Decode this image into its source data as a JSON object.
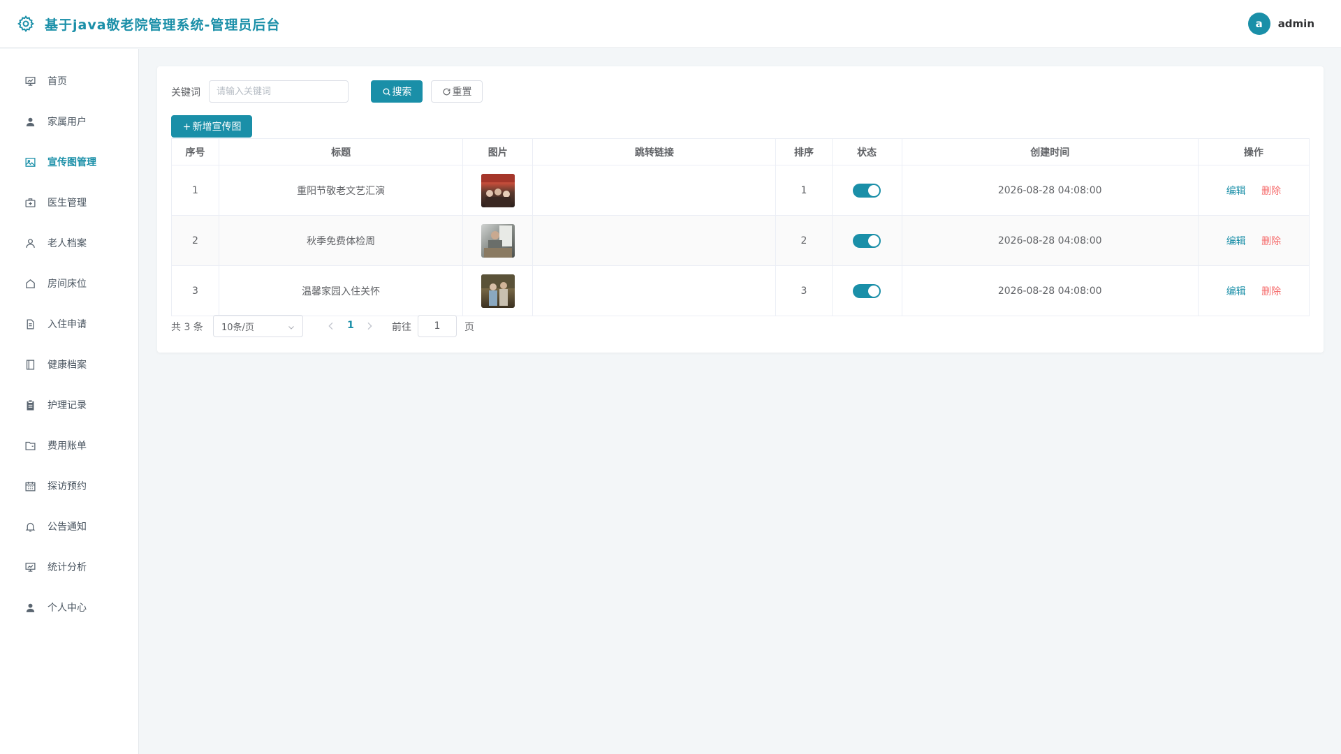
{
  "header": {
    "title": "基于java敬老院管理系统-管理员后台",
    "user": {
      "avatar_letter": "a",
      "name": "admin"
    }
  },
  "sidebar": {
    "items": [
      {
        "label": "首页",
        "icon": "chart-board-icon",
        "active": false
      },
      {
        "label": "家属用户",
        "icon": "user-icon",
        "active": false
      },
      {
        "label": "宣传图管理",
        "icon": "picture-icon",
        "active": true
      },
      {
        "label": "医生管理",
        "icon": "first-aid-icon",
        "active": false
      },
      {
        "label": "老人档案",
        "icon": "user-outline-icon",
        "active": false
      },
      {
        "label": "房间床位",
        "icon": "house-icon",
        "active": false
      },
      {
        "label": "入住申请",
        "icon": "document-icon",
        "active": false
      },
      {
        "label": "健康档案",
        "icon": "notebook-icon",
        "active": false
      },
      {
        "label": "护理记录",
        "icon": "clipboard-icon",
        "active": false
      },
      {
        "label": "费用账单",
        "icon": "wallet-icon",
        "active": false
      },
      {
        "label": "探访预约",
        "icon": "calendar-icon",
        "active": false
      },
      {
        "label": "公告通知",
        "icon": "bell-icon",
        "active": false
      },
      {
        "label": "统计分析",
        "icon": "chart-board-icon",
        "active": false
      },
      {
        "label": "个人中心",
        "icon": "user-icon",
        "active": false
      }
    ]
  },
  "search": {
    "label": "关键词",
    "placeholder": "请输入关键词",
    "value": "",
    "search_button": "搜索",
    "reset_button": "重置"
  },
  "add_button": "新增宣传图",
  "table": {
    "columns": [
      "序号",
      "标题",
      "图片",
      "跳转链接",
      "排序",
      "状态",
      "创建时间",
      "操作"
    ],
    "rows": [
      {
        "index": "1",
        "title": "重阳节敬老文艺汇演",
        "link": "",
        "sort": "1",
        "status_on": true,
        "created": "2026-08-28 04:08:00"
      },
      {
        "index": "2",
        "title": "秋季免费体检周",
        "link": "",
        "sort": "2",
        "status_on": true,
        "created": "2026-08-28 04:08:00"
      },
      {
        "index": "3",
        "title": "温馨家园入住关怀",
        "link": "",
        "sort": "3",
        "status_on": true,
        "created": "2026-08-28 04:08:00"
      }
    ],
    "actions": {
      "edit": "编辑",
      "delete": "删除"
    }
  },
  "pagination": {
    "total_text": "共 3 条",
    "page_size": "10条/页",
    "current_page": "1",
    "goto_label": "前往",
    "goto_value": "1",
    "page_suffix": "页"
  },
  "colors": {
    "accent": "#1a8fa8",
    "danger": "#f56c6c",
    "background": "#f3f6f8"
  }
}
